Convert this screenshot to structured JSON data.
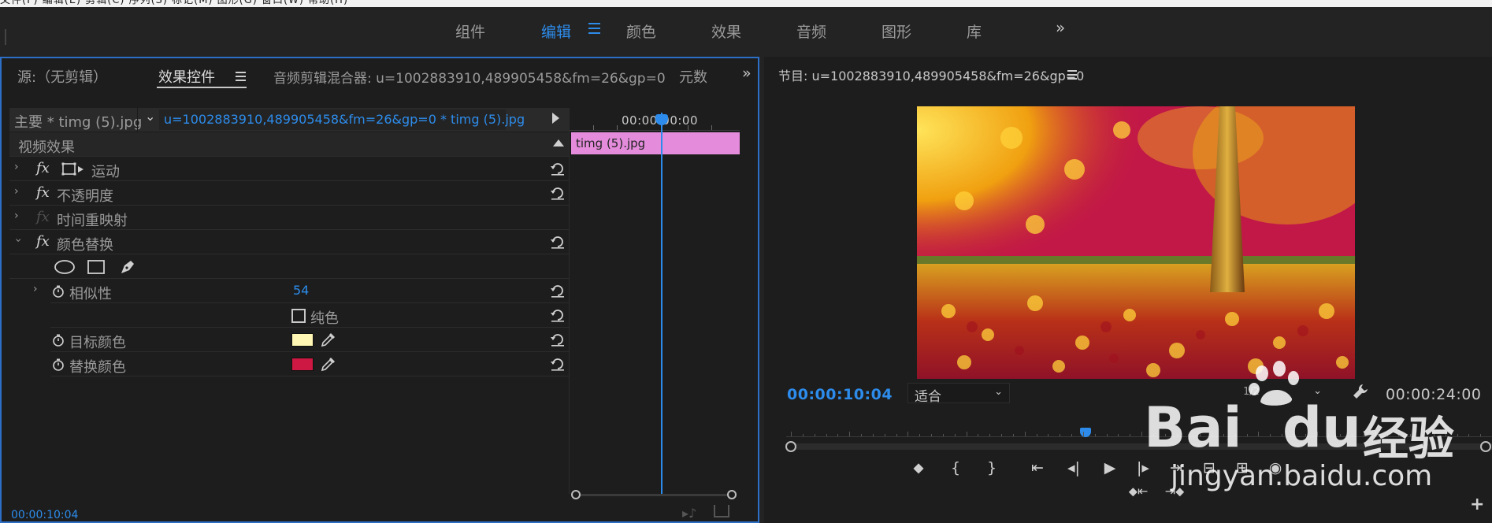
{
  "menubar": {
    "text": "文件(F)  编辑(E)  剪辑(C)  序列(S)  标记(M)  图形(G)  窗口(W)  帮助(H)"
  },
  "workspace": {
    "tabs": [
      {
        "label": "组件",
        "active": false
      },
      {
        "label": "编辑",
        "active": true
      },
      {
        "label": "颜色",
        "active": false
      },
      {
        "label": "效果",
        "active": false
      },
      {
        "label": "音频",
        "active": false
      },
      {
        "label": "图形",
        "active": false
      },
      {
        "label": "库",
        "active": false
      }
    ],
    "more_icon": "double-chevron-right-icon"
  },
  "left_panel": {
    "tabs": [
      {
        "label": "源:（无剪辑）"
      },
      {
        "label": "效果控件"
      },
      {
        "label": "音频剪辑混合器: u=1002883910,489905458&fm=26&gp=0"
      },
      {
        "label": "元数"
      }
    ],
    "effect_controls": {
      "master_label": "主要 * timg (5).jpg",
      "clip_label": "u=1002883910,489905458&fm=26&gp=0 * timg (5).jpg",
      "section_title": "视频效果",
      "effects": [
        {
          "name": "运动"
        },
        {
          "name": "不透明度"
        },
        {
          "name": "时间重映射"
        },
        {
          "name": "颜色替换"
        }
      ],
      "fx_label": "fx",
      "params": {
        "similarity": {
          "label": "相似性",
          "value": "54"
        },
        "solid": {
          "label": "纯色"
        },
        "target_color": {
          "label": "目标颜色",
          "color": "#fff7b3"
        },
        "replace_color": {
          "label": "替换颜色",
          "color": "#cc1842"
        }
      }
    },
    "timeline": {
      "time": "00:00:00:00",
      "clip_label": "timg (5).jpg",
      "clip_color": "#e48cdb"
    },
    "footer_timecode": "00:00:10:04"
  },
  "program": {
    "title": "节目: u=1002883910,489905458&fm=26&gp=0",
    "timecode": "00:00:10:04",
    "fit": "适合",
    "resolution": "1/2",
    "duration": "00:00:24:00",
    "playhead_fraction": 0.42
  },
  "watermark": {
    "brand": "Bai",
    "brand2": "du",
    "cn": "经验",
    "url": "jingyan.baidu.com"
  },
  "colors": {
    "accent": "#2d8ceb",
    "panel_border": "#2d6fc6"
  }
}
